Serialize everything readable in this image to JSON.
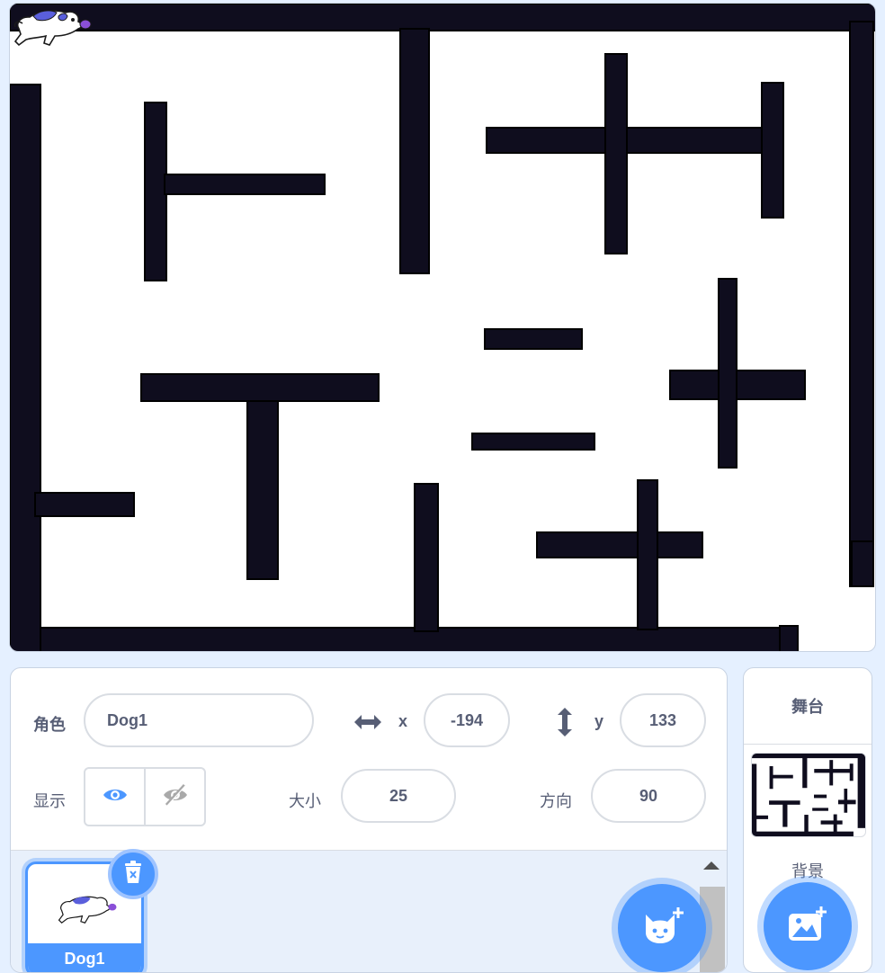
{
  "stage": {
    "sprite_name": "Dog1",
    "backdrop_name": "maze"
  },
  "sprite_info": {
    "sprite_label": "角色",
    "sprite_name": "Dog1",
    "x_label": "x",
    "x_value": "-194",
    "y_label": "y",
    "y_value": "133",
    "show_label": "显示",
    "size_label": "大小",
    "size_value": "25",
    "direction_label": "方向",
    "direction_value": "90"
  },
  "sprite_list": {
    "items": [
      {
        "name": "Dog1",
        "selected": true
      }
    ]
  },
  "stage_panel": {
    "title": "舞台",
    "backdrop_label": "背景"
  },
  "icons": {
    "x_icon": "horizontal-arrows-icon",
    "y_icon": "vertical-arrows-icon",
    "show": "eye-icon",
    "hide": "eye-slash-icon",
    "delete": "trash-icon",
    "add_sprite": "cat-plus-icon",
    "add_backdrop": "image-plus-icon"
  },
  "colors": {
    "accent": "#4c97ff",
    "wall": "#0f0d1e",
    "text": "#575e75",
    "background": "#e5f0ff"
  }
}
